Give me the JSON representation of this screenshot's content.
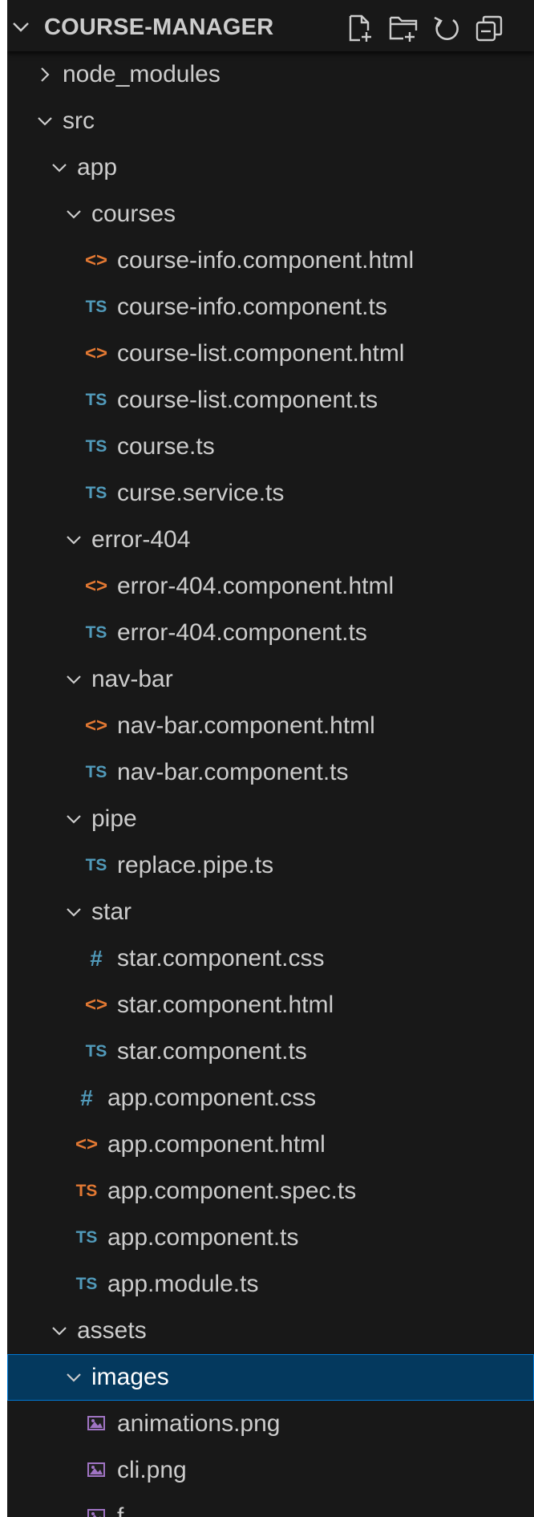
{
  "explorer": {
    "title": "COURSE-MANAGER",
    "actions": [
      {
        "name": "new-file-icon"
      },
      {
        "name": "new-folder-icon"
      },
      {
        "name": "refresh-icon"
      },
      {
        "name": "collapse-all-icon"
      }
    ]
  },
  "colors": {
    "background": "#181818",
    "selected": "#04395e",
    "selected_border": "#0078d4",
    "html_icon": "#e37933",
    "ts_icon": "#519aba",
    "spec_ts_icon": "#e37933",
    "css_icon": "#519aba",
    "image_icon": "#a074c4",
    "text": "#cccccc"
  },
  "tree": [
    {
      "label": "node_modules",
      "depth": 1,
      "type": "folder",
      "expanded": false
    },
    {
      "label": "src",
      "depth": 1,
      "type": "folder",
      "expanded": true
    },
    {
      "label": "app",
      "depth": 2,
      "type": "folder",
      "expanded": true
    },
    {
      "label": "courses",
      "depth": 3,
      "type": "folder",
      "expanded": true
    },
    {
      "label": "course-info.component.html",
      "depth": 4,
      "type": "html",
      "icon": "html-file-icon",
      "glyph": "<>"
    },
    {
      "label": "course-info.component.ts",
      "depth": 4,
      "type": "ts",
      "icon": "typescript-file-icon",
      "glyph": "TS"
    },
    {
      "label": "course-list.component.html",
      "depth": 4,
      "type": "html",
      "icon": "html-file-icon",
      "glyph": "<>"
    },
    {
      "label": "course-list.component.ts",
      "depth": 4,
      "type": "ts",
      "icon": "typescript-file-icon",
      "glyph": "TS"
    },
    {
      "label": "course.ts",
      "depth": 4,
      "type": "ts",
      "icon": "typescript-file-icon",
      "glyph": "TS"
    },
    {
      "label": "curse.service.ts",
      "depth": 4,
      "type": "ts",
      "icon": "typescript-file-icon",
      "glyph": "TS"
    },
    {
      "label": "error-404",
      "depth": 3,
      "type": "folder",
      "expanded": true
    },
    {
      "label": "error-404.component.html",
      "depth": 4,
      "type": "html",
      "icon": "html-file-icon",
      "glyph": "<>"
    },
    {
      "label": "error-404.component.ts",
      "depth": 4,
      "type": "ts",
      "icon": "typescript-file-icon",
      "glyph": "TS"
    },
    {
      "label": "nav-bar",
      "depth": 3,
      "type": "folder",
      "expanded": true
    },
    {
      "label": "nav-bar.component.html",
      "depth": 4,
      "type": "html",
      "icon": "html-file-icon",
      "glyph": "<>"
    },
    {
      "label": "nav-bar.component.ts",
      "depth": 4,
      "type": "ts",
      "icon": "typescript-file-icon",
      "glyph": "TS"
    },
    {
      "label": "pipe",
      "depth": 3,
      "type": "folder",
      "expanded": true
    },
    {
      "label": "replace.pipe.ts",
      "depth": 4,
      "type": "ts",
      "icon": "typescript-file-icon",
      "glyph": "TS"
    },
    {
      "label": "star",
      "depth": 3,
      "type": "folder",
      "expanded": true
    },
    {
      "label": "star.component.css",
      "depth": 4,
      "type": "css",
      "icon": "css-file-icon",
      "glyph": "#"
    },
    {
      "label": "star.component.html",
      "depth": 4,
      "type": "html",
      "icon": "html-file-icon",
      "glyph": "<>"
    },
    {
      "label": "star.component.ts",
      "depth": 4,
      "type": "ts",
      "icon": "typescript-file-icon",
      "glyph": "TS"
    },
    {
      "label": "app.component.css",
      "depth": 3,
      "type": "css",
      "icon": "css-file-icon",
      "glyph": "#"
    },
    {
      "label": "app.component.html",
      "depth": 3,
      "type": "html",
      "icon": "html-file-icon",
      "glyph": "<>"
    },
    {
      "label": "app.component.spec.ts",
      "depth": 3,
      "type": "spec",
      "icon": "typescript-spec-file-icon",
      "glyph": "TS"
    },
    {
      "label": "app.component.ts",
      "depth": 3,
      "type": "ts",
      "icon": "typescript-file-icon",
      "glyph": "TS"
    },
    {
      "label": "app.module.ts",
      "depth": 3,
      "type": "ts",
      "icon": "typescript-file-icon",
      "glyph": "TS"
    },
    {
      "label": "assets",
      "depth": 2,
      "type": "folder",
      "expanded": true
    },
    {
      "label": "images",
      "depth": 3,
      "type": "folder",
      "expanded": true,
      "selected": true
    },
    {
      "label": "animations.png",
      "depth": 4,
      "type": "image",
      "icon": "image-file-icon"
    },
    {
      "label": "cli.png",
      "depth": 4,
      "type": "image",
      "icon": "image-file-icon"
    },
    {
      "label": "f...",
      "depth": 4,
      "type": "image",
      "icon": "image-file-icon"
    }
  ]
}
